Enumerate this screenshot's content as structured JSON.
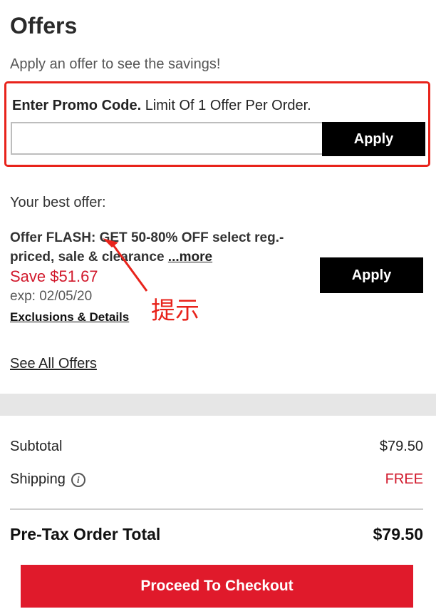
{
  "offers": {
    "title": "Offers",
    "subtitle": "Apply an offer to see the savings!"
  },
  "promo": {
    "label_bold": "Enter Promo Code.",
    "label_rest": " Limit Of 1 Offer Per Order.",
    "input_value": "",
    "apply_label": "Apply"
  },
  "best_offer": {
    "heading": "Your best offer:",
    "description": "Offer FLASH: GET 50-80% OFF select reg.-priced, sale & clearance ",
    "more_link": "...more",
    "savings": "Save $51.67",
    "expiration": "exp: 02/05/20",
    "exclusions_link": "Exclusions & Details",
    "apply_label": "Apply"
  },
  "annotation": {
    "text": "提示",
    "color": "#e8231b"
  },
  "see_all_link": "See All Offers",
  "summary": {
    "subtotal_label": "Subtotal",
    "subtotal_value": "$79.50",
    "shipping_label": "Shipping",
    "shipping_info_icon": "info-icon",
    "shipping_value": "FREE",
    "total_label": "Pre-Tax Order Total",
    "total_value": "$79.50"
  },
  "checkout_label": "Proceed To Checkout",
  "colors": {
    "accent_red": "#e01a2b",
    "highlight_border": "#e8231b",
    "button_black": "#000000"
  }
}
